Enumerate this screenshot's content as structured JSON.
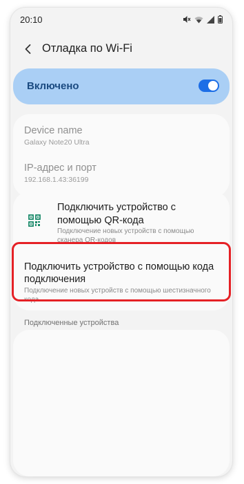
{
  "status_bar": {
    "time": "20:10",
    "icons": [
      "mute-icon",
      "wifi-icon",
      "signal-icon",
      "battery-icon"
    ]
  },
  "app_bar": {
    "title": "Отладка по Wi‑Fi"
  },
  "master_switch": {
    "label": "Включено",
    "state": "on",
    "accent": "#1d6ee6",
    "background": "#aacff5"
  },
  "info": {
    "device_name": {
      "title": "Device name",
      "value": "Galaxy Note20 Ultra"
    },
    "ip_port": {
      "title": "IP-адрес и порт",
      "value": "192.168.1.43:36199"
    }
  },
  "pair_options": [
    {
      "icon": "qr-code-icon",
      "title": "Подключить устройство с помощью QR-кода",
      "subtitle": "Подключение новых устройств с помощью сканера QR-кодов"
    },
    {
      "title": "Подключить устройство с помощью кода подключения",
      "subtitle": "Подключение новых устройств с помощью шестизначного кода"
    }
  ],
  "paired_devices": {
    "header": "Подключенные устройства"
  },
  "highlight_color": "#e52126"
}
